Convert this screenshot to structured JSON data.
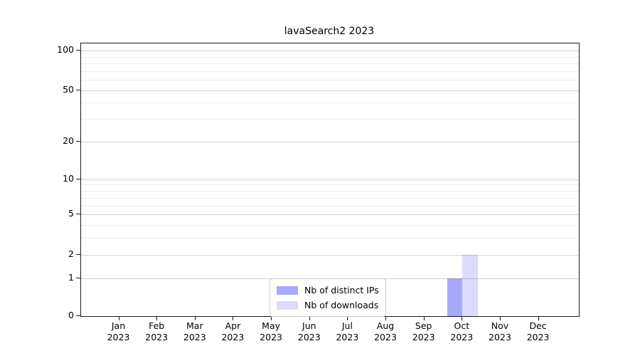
{
  "chart_data": {
    "type": "bar",
    "title": "lavaSearch2 2023",
    "categories": [
      "Jan",
      "Feb",
      "Mar",
      "Apr",
      "May",
      "Jun",
      "Jul",
      "Aug",
      "Sep",
      "Oct",
      "Nov",
      "Dec"
    ],
    "x_sublabel": "2023",
    "series": [
      {
        "name": "Nb of distinct IPs",
        "color": "rgba(0,0,240,0.34)",
        "values": [
          0,
          0,
          0,
          0,
          0,
          0,
          0,
          0,
          0,
          1,
          0,
          0
        ]
      },
      {
        "name": "Nb of downloads",
        "color": "rgba(0,0,240,0.14)",
        "values": [
          0,
          0,
          0,
          0,
          0,
          0,
          0,
          0,
          0,
          2,
          0,
          0
        ]
      }
    ],
    "yscale": "log10(1+y)",
    "ylim": [
      0,
      113
    ],
    "y_major_ticks": [
      0,
      1,
      2,
      5,
      10,
      20,
      50,
      100
    ],
    "y_minor_gridlines": [
      3,
      4,
      6,
      7,
      8,
      9,
      30,
      40,
      60,
      70,
      80,
      90
    ],
    "grid": true,
    "legend_position": "lower center",
    "colors": {
      "background": "#ffffff",
      "spine": "#1a1a1a",
      "major_grid": "rgba(0,0,0,0.18)",
      "minor_grid": "rgba(0,0,0,0.07)",
      "text": "#000000"
    }
  }
}
